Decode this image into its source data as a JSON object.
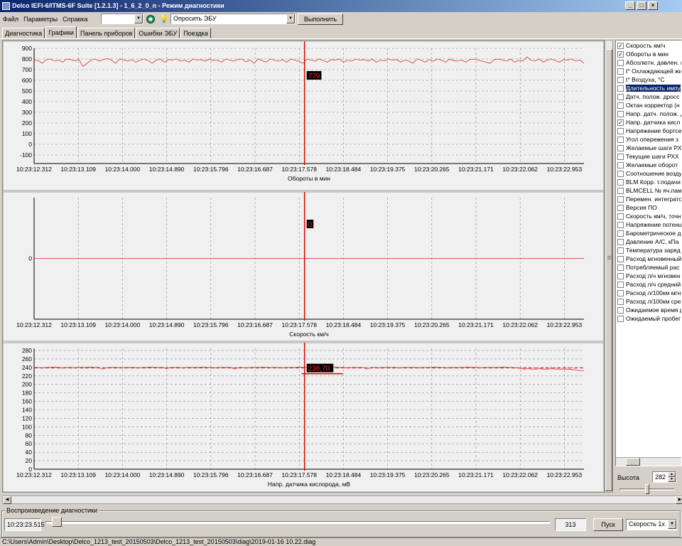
{
  "window": {
    "title": "Delco IEFI-6/ITMS-6F Suite [1.2.1.3] - 1_6_2_0_n - Режим диагностики",
    "app_icon": "car-icon",
    "min_glyph": "_",
    "max_glyph": "□",
    "close_glyph": "×"
  },
  "menu": [
    {
      "label": "Файл"
    },
    {
      "label": "Параметры"
    },
    {
      "label": "Справка"
    }
  ],
  "toolbar": {
    "port_value": "",
    "command_value": "Опросить ЭБУ",
    "execute_label": "Выполнить",
    "combo_arrow": "▼",
    "bulb_glyph": "💡"
  },
  "tabs": [
    {
      "label": "Диагностика",
      "active": false
    },
    {
      "label": "Графики",
      "active": true
    },
    {
      "label": "Панель приборов",
      "active": false
    },
    {
      "label": "Ошибки ЭБУ",
      "active": false
    },
    {
      "label": "Поездка",
      "active": false
    }
  ],
  "chart_data": [
    {
      "type": "line",
      "xlabel": "Обороты в мин",
      "x_ticks": [
        "10:23:12.312",
        "10:23:13.109",
        "10:23:14.000",
        "10:23:14.890",
        "10:23:15.796",
        "10:23:16.687",
        "10:23:17.578",
        "10:23:18.484",
        "10:23:19.375",
        "10:23:20.265",
        "10:23:21.171",
        "10:23:22.062",
        "10:23:22.953"
      ],
      "y_ticks": [
        900,
        800,
        700,
        600,
        500,
        400,
        300,
        200,
        100,
        0,
        -100
      ],
      "ylim": [
        -180,
        900
      ],
      "grid": true,
      "cursor_value": "779",
      "cursor_x": 6.12,
      "series": [
        {
          "color": "#e03030",
          "values": [
            790,
            785,
            760,
            795,
            800,
            780,
            790,
            770,
            800,
            795,
            780,
            795,
            730,
            760,
            790,
            800,
            780,
            795,
            805,
            790,
            760,
            800,
            790,
            780,
            795,
            770,
            790,
            800,
            785,
            760,
            790,
            800,
            770,
            795,
            790,
            800,
            780,
            790,
            770,
            800,
            790,
            795,
            780,
            800,
            785,
            790,
            770,
            800,
            790,
            780,
            795,
            800,
            775,
            790,
            760,
            800,
            785,
            770,
            800,
            790,
            780,
            795,
            770,
            800,
            790,
            780,
            760,
            800,
            790,
            780,
            800,
            785,
            770,
            795,
            790,
            800,
            770,
            790,
            780,
            800,
            790,
            795,
            780,
            800,
            770,
            790,
            780,
            800,
            790,
            795,
            770,
            790,
            780,
            760,
            800,
            790,
            770,
            795,
            780,
            800,
            790,
            770,
            800,
            785,
            780,
            790,
            770,
            795,
            800,
            790,
            780,
            770,
            760,
            795,
            800,
            790,
            780,
            800,
            770,
            790,
            780,
            820,
            790,
            780,
            800,
            770,
            790,
            800,
            785,
            770,
            795,
            790,
            800,
            780,
            790,
            760
          ]
        }
      ]
    },
    {
      "type": "line",
      "xlabel": "Скорость км/ч",
      "x_ticks": [
        "10:23:12.312",
        "10:23:13.109",
        "10:23:14.000",
        "10:23:14.890",
        "10:23:15.796",
        "10:23:16.687",
        "10:23:17.578",
        "10:23:18.484",
        "10:23:19.375",
        "10:23:20.265",
        "10:23:21.171",
        "10:23:22.062",
        "10:23:22.953"
      ],
      "y_ticks": [
        0
      ],
      "ylim": [
        -1,
        1
      ],
      "grid": true,
      "cursor_value": "0",
      "cursor_x": 6.12,
      "series": [
        {
          "color": "#e03030",
          "values": [
            0,
            0
          ]
        }
      ]
    },
    {
      "type": "line",
      "xlabel": "Напр. датчика кислорода, мВ",
      "x_ticks": [
        "10:23:12.312",
        "10:23:13.109",
        "10:23:14.000",
        "10:23:14.890",
        "10:23:15.796",
        "10:23:16.687",
        "10:23:17.578",
        "10:23:18.484",
        "10:23:19.375",
        "10:23:20.265",
        "10:23:21.171",
        "10:23:22.062",
        "10:23:22.953"
      ],
      "y_ticks": [
        280,
        260,
        240,
        220,
        200,
        180,
        160,
        140,
        120,
        100,
        80,
        60,
        40,
        20,
        0
      ],
      "ylim": [
        0,
        285
      ],
      "grid": true,
      "cursor_value": "238,70",
      "cursor_x": 6.12,
      "reference_line": 238.7,
      "series": [
        {
          "color": "#e03030",
          "values": [
            240,
            240,
            239,
            240,
            240,
            241,
            240,
            239,
            240,
            240,
            239,
            240,
            240,
            240,
            241,
            240,
            240,
            236,
            239,
            240,
            240,
            240,
            239,
            240,
            240,
            240,
            239,
            240,
            240,
            241,
            240,
            240,
            240,
            237,
            240,
            240,
            240,
            239,
            240,
            240,
            240,
            240,
            241,
            240,
            240,
            239,
            240,
            240,
            240,
            240,
            236,
            240,
            240,
            239,
            240,
            240,
            240,
            241,
            240,
            240,
            240,
            240,
            239,
            240,
            240,
            240,
            241,
            240,
            240,
            239,
            240,
            240,
            240,
            240,
            240,
            241,
            240,
            240,
            239,
            240,
            240,
            240,
            240,
            236,
            240,
            240,
            239,
            240,
            240,
            240,
            240,
            239,
            240,
            240,
            240,
            240,
            239,
            240,
            240,
            240,
            241,
            240,
            240,
            239,
            240,
            240,
            240,
            240,
            241,
            240,
            240,
            239,
            240,
            240,
            240,
            240,
            240,
            241,
            240,
            240,
            239,
            238,
            236,
            237,
            236,
            236,
            237,
            236,
            236,
            237,
            236,
            236,
            236,
            236,
            235,
            234,
            232,
            232
          ]
        }
      ]
    }
  ],
  "params": [
    {
      "label": "Скорость км/ч",
      "checked": true,
      "selected": false
    },
    {
      "label": "Обороты в мин",
      "checked": true,
      "selected": false
    },
    {
      "label": "Абсолютн. давлен. в",
      "checked": false,
      "selected": false
    },
    {
      "label": "t° Охлаждающей жи",
      "checked": false,
      "selected": false
    },
    {
      "label": "t° Воздуха, °C",
      "checked": false,
      "selected": false
    },
    {
      "label": "Длительность импу",
      "checked": false,
      "selected": true
    },
    {
      "label": "Датч. полож. дросс",
      "checked": false,
      "selected": false
    },
    {
      "label": "Октан корректор (н",
      "checked": false,
      "selected": false
    },
    {
      "label": "Напр. датч. полож. д",
      "checked": false,
      "selected": false
    },
    {
      "label": "Напр. датчика кисл",
      "checked": true,
      "selected": false
    },
    {
      "label": "Напряжение бортсе",
      "checked": false,
      "selected": false
    },
    {
      "label": "Угол опережения з",
      "checked": false,
      "selected": false
    },
    {
      "label": "Желаемые шаги РХ",
      "checked": false,
      "selected": false
    },
    {
      "label": "Текущие шаги РХХ",
      "checked": false,
      "selected": false
    },
    {
      "label": "Желаемые оборот",
      "checked": false,
      "selected": false
    },
    {
      "label": "Соотношение возду",
      "checked": false,
      "selected": false
    },
    {
      "label": "BLM Корр. т.подачи",
      "checked": false,
      "selected": false
    },
    {
      "label": "BLMCELL № яч.пам",
      "checked": false,
      "selected": false
    },
    {
      "label": "Перемен. интеграто",
      "checked": false,
      "selected": false
    },
    {
      "label": "Версия ПО",
      "checked": false,
      "selected": false
    },
    {
      "label": "Скорость км/ч, точн",
      "checked": false,
      "selected": false
    },
    {
      "label": "Напряжение потенц",
      "checked": false,
      "selected": false
    },
    {
      "label": "Барометрическое д",
      "checked": false,
      "selected": false
    },
    {
      "label": "Давление А/С, кПа",
      "checked": false,
      "selected": false
    },
    {
      "label": "Температура заряд",
      "checked": false,
      "selected": false
    },
    {
      "label": "Расход мгновенный",
      "checked": false,
      "selected": false
    },
    {
      "label": "Потребляемый рас",
      "checked": false,
      "selected": false
    },
    {
      "label": "Расход л/ч мгновен",
      "checked": false,
      "selected": false
    },
    {
      "label": "Расход л/ч средний",
      "checked": false,
      "selected": false
    },
    {
      "label": "Расход л/100км мгн",
      "checked": false,
      "selected": false
    },
    {
      "label": "Расход л/100км сре",
      "checked": false,
      "selected": false
    },
    {
      "label": "Ожидаемое время р",
      "checked": false,
      "selected": false
    },
    {
      "label": "Ожидаемый пробег",
      "checked": false,
      "selected": false
    }
  ],
  "check_glyph": "✓",
  "height_control": {
    "label": "Высота",
    "value": "282",
    "up": "▲",
    "down": "▼"
  },
  "playback": {
    "legend": "Воспроизведение диагностики",
    "time": "10:23:23.515",
    "position": "313",
    "progress": 0.01,
    "start_label": "Пуск",
    "speed_value": "Скорость 1х"
  },
  "scroll_glyphs": {
    "up": "▲",
    "down": "▼",
    "left": "◀",
    "right": "▶"
  },
  "status": {
    "path": "C:\\Users\\Admin\\Desktop\\Delco_1213_test_20150503\\Delco_1213_test_20150503\\diag\\2019-01-16 10.22.diag"
  }
}
